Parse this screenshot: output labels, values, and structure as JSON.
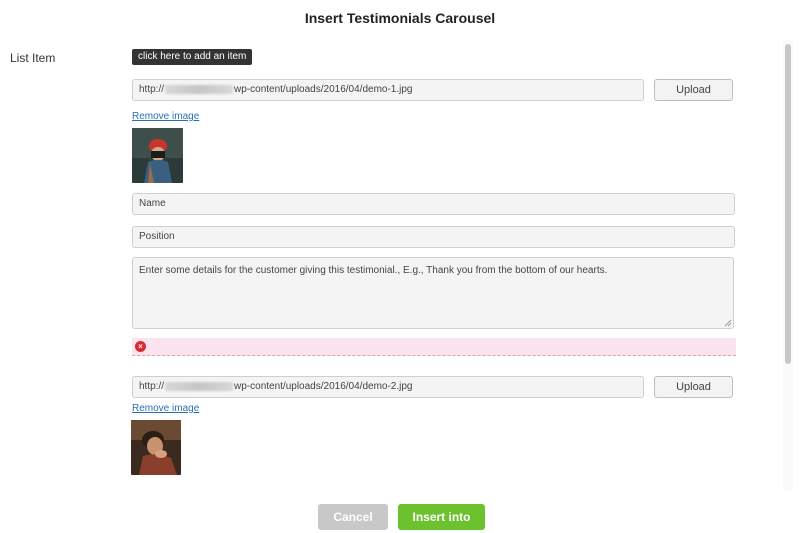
{
  "dialog": {
    "title": "Insert Testimonials Carousel"
  },
  "list": {
    "label": "List Item",
    "add_tooltip": "click here to add an item"
  },
  "items": [
    {
      "image_url_prefix": "http://",
      "image_url_suffix": "wp-content/uploads/2016/04/demo-1.jpg",
      "upload_label": "Upload",
      "remove_label": "Remove image",
      "name_placeholder": "Name",
      "position_placeholder": "Position",
      "details_placeholder": "Enter some details for the customer giving this testimonial., E.g., Thank you from the bottom of our hearts."
    },
    {
      "image_url_prefix": "http://",
      "image_url_suffix": "wp-content/uploads/2016/04/demo-2.jpg",
      "upload_label": "Upload",
      "remove_label": "Remove image"
    }
  ],
  "footer": {
    "cancel_label": "Cancel",
    "insert_label": "Insert into"
  },
  "colors": {
    "insert_button": "#6cc12f",
    "cancel_button": "#c8c8c8",
    "link": "#2a6fb5",
    "error_icon": "#d9292f",
    "error_bg": "#fbe4ee"
  },
  "icons": {
    "error": "error-x-circle-icon",
    "resize": "resize-grip-icon"
  }
}
